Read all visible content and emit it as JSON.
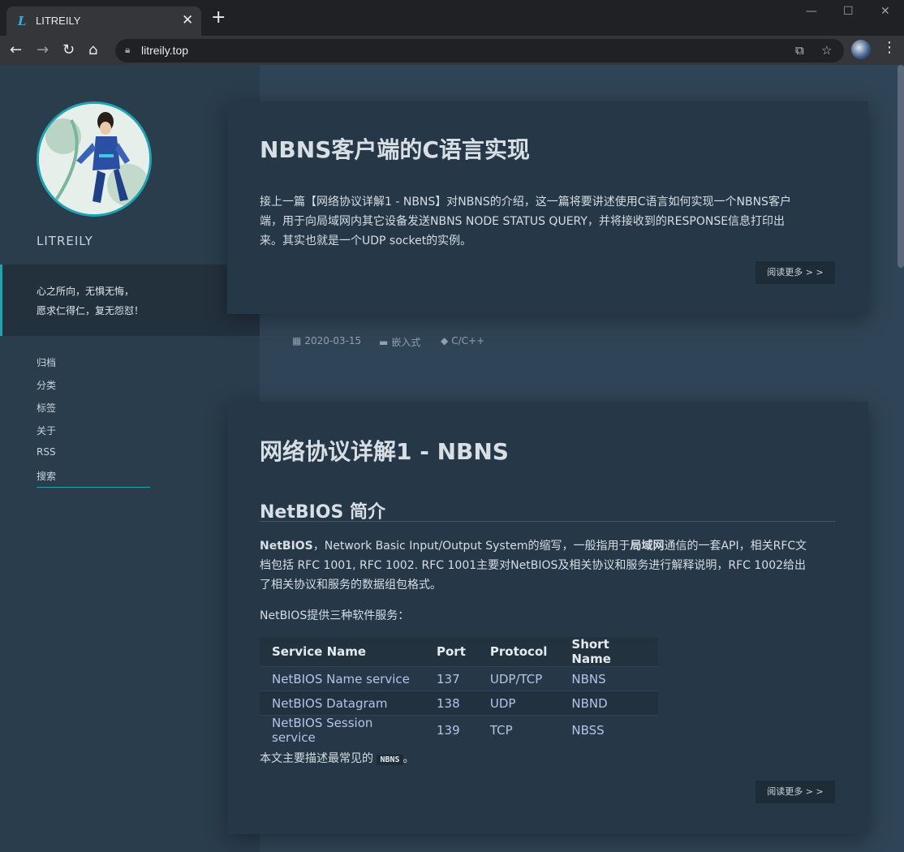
{
  "browser": {
    "tab_title": "LITREILY",
    "favicon": "L",
    "url": "litreily.top",
    "icons": [
      "back-icon",
      "forward-icon",
      "reload-icon",
      "home-icon",
      "lock-icon",
      "translate-icon",
      "star-icon",
      "menu-icon"
    ]
  },
  "sidebar": {
    "site_name": "LITREILY",
    "motto_line1": "心之所向，无惧无悔，",
    "motto_line2": "愿求仁得仁，复无怨怼！",
    "nav": [
      "归档",
      "分类",
      "标签",
      "关于",
      "RSS",
      "搜索"
    ]
  },
  "posts": [
    {
      "title": "NBNS客户端的C语言实现",
      "excerpt_1": "接上一篇【网络协议详解1 - NBNS】对NBNS的介绍，这一篇将要讲述使用C语言如何实现一个NBNS客户",
      "excerpt_2": "端，用于向局域网内其它设备发送NBNS NODE STATUS QUERY，并将接收到的RESPONSE信息打印出",
      "excerpt_3": "来。其实也就是一个UDP socket的实例。",
      "read_more": "阅读更多 > >",
      "date": "2020-03-15",
      "category": "嵌入式",
      "tag": "C/C++"
    },
    {
      "title": "网络协议详解1 - NBNS",
      "subtitle": "NetBIOS 简介",
      "p1_bold": "NetBIOS",
      "p1_a": "，Network Basic Input/Output System的缩写，一般指用于",
      "p1_bold2": "局域网",
      "p1_b": "通信的一套API，相关RFC文",
      "p1_line2": "档包括 RFC 1001, RFC 1002. RFC 1001主要对NetBIOS及相关协议和服务进行解释说明，RFC 1002给出",
      "p1_line3": "了相关协议和服务的数据组包格式。",
      "p2": "NetBIOS提供三种软件服务：",
      "table_headers": [
        "Service Name",
        "Port",
        "Protocol",
        "Short Name"
      ],
      "table_rows": [
        [
          "NetBIOS Name service",
          "137",
          "UDP/TCP",
          "NBNS"
        ],
        [
          "NetBIOS Datagram",
          "138",
          "UDP",
          "NBND"
        ],
        [
          "NetBIOS Session service",
          "139",
          "TCP",
          "NBSS"
        ]
      ],
      "p3_a": "本文主要描述最常见的",
      "p3_code": "NBNS",
      "p3_b": "。",
      "read_more": "阅读更多 > >"
    }
  ]
}
